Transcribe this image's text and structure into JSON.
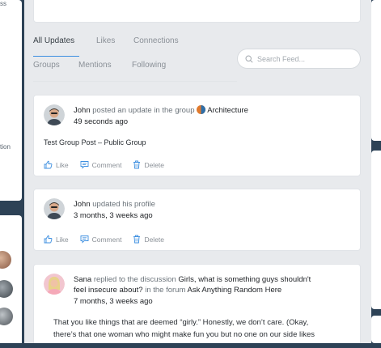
{
  "left_panel": {
    "crop_text_top": "ss",
    "crop_text_mid": "tion"
  },
  "tabs": {
    "all_updates": "All Updates",
    "likes": "Likes",
    "connections": "Connections",
    "groups": "Groups",
    "mentions": "Mentions",
    "following": "Following"
  },
  "search": {
    "placeholder": "Search Feed..."
  },
  "actions": {
    "like": "Like",
    "comment": "Comment",
    "delete": "Delete"
  },
  "activities": [
    {
      "user": "John",
      "action_text": " posted an update in the group ",
      "target": "Architecture",
      "time": "49 seconds ago",
      "content": "Test Group Post – Public Group"
    },
    {
      "user": "John",
      "action_text": " updated his profile",
      "time": "3 months, 3 weeks ago"
    },
    {
      "user": "Sana",
      "action_text_1": " replied to the discussion ",
      "discussion": "Girls, what is something guys shouldn't",
      "discussion_cont": "feel insecure about?",
      "in_forum": " in the forum ",
      "forum": "Ask Anything Random Here",
      "time": "7 months, 3 weeks ago",
      "content_line1": "That you like things that are deemed “girly.” Honestly, we don’t care. (Okay,",
      "content_line2": "there’s that one woman who might make fun you but no one on our side likes"
    }
  ],
  "colors": {
    "accent": "#3d8fe0",
    "frame": "#2d4256"
  }
}
